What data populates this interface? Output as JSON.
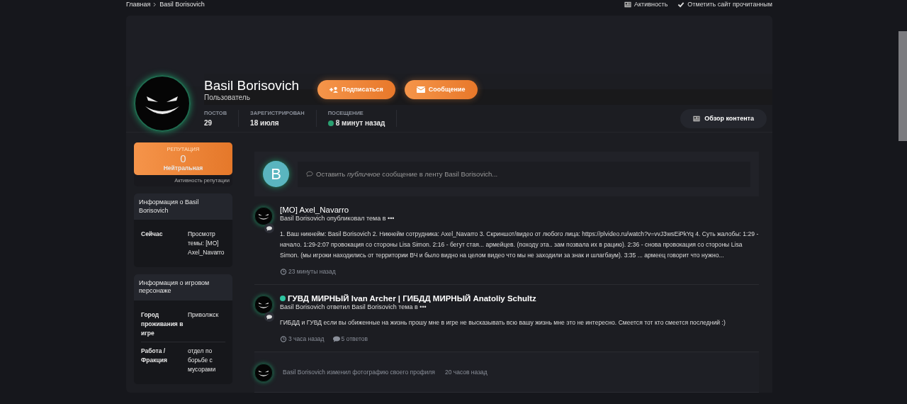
{
  "breadcrumb": [
    {
      "label": "Главная"
    },
    {
      "label": "Basil Borisovich"
    }
  ],
  "top_links": [
    {
      "kind": "activity",
      "label": "Активность"
    },
    {
      "kind": "mark_read",
      "label": "Отметить сайт прочитанным"
    }
  ],
  "profile": {
    "name": "Basil Borisovich",
    "group": "Пользователь",
    "online": true,
    "buttons": [
      {
        "kind": "follow",
        "label": "Подписаться"
      },
      {
        "kind": "message",
        "label": "Сообщение"
      }
    ],
    "stats": [
      {
        "label": "ПОСТОВ",
        "value": "29"
      },
      {
        "label": "ЗАРЕГИСТРИРОВАН",
        "value": "18 июля"
      },
      {
        "label": "ПОСЕЩЕНИЕ",
        "value": "8 минут назад",
        "online": true
      }
    ],
    "content_button": "Обзор контента"
  },
  "reputation": {
    "title": "РЕПУТАЦИЯ",
    "value": "0",
    "text": "Нейтральная",
    "link": "Активность репутации"
  },
  "info_blocks": [
    {
      "title": "Информация о Basil Borisovich",
      "rows": [
        {
          "label": "Сейчас",
          "value": "Просмотр темы: [MO] Axel_Navarro"
        }
      ]
    },
    {
      "title": "Информация о игровом персонаже",
      "rows": [
        {
          "label": "Город проживания в игре",
          "value": "Приволжск"
        },
        {
          "label": "Работа / Фракция",
          "value": "отдел по борьбе с мусорами"
        }
      ]
    }
  ],
  "composer": {
    "avatar_letter": "B",
    "placeholder": "Оставить *публичное* сообщение в ленту Basil Borisovich..."
  },
  "feed": [
    {
      "kind": "topic",
      "title": "[MO] Axel_Navarro",
      "online": false,
      "subtitle": "Basil Borisovich опубликовал тема в •••",
      "body": "1. Ваш никнейм: Basil Borisovich 2. Никнейм сотрудника: Axel_Navarro 3. Скриншот/видео от любого лица: https://plvideo.ru/watch?v=vvJ3wsEiPkYq 4. Суть жалобы: 1:29 - начало. 1:29-2:07 провокация со стороны Lisa Simon. 2:16 - бегут стая... армейцев. (походу эта.. зам позвала их в рацию). 2:36 - снова провокация со стороны Lisa Simon. (мы игроки находились от территории ВЧ и было видно на целом видео что мы не заходили за знак и шлагбаум). 3:35 ... армеец говорит что нужно...",
      "time": "23 минуты назад"
    },
    {
      "kind": "topic",
      "title": "ГУВД МИРНЫЙ Ivan Archer | ГИБДД МИРНЫЙ Anatoliy Schultz",
      "online": true,
      "subtitle": "Basil Borisovich ответил Basil Borisovich тема в •••",
      "body": "ГИБДД и ГУВД если вы обиженные на жизнь прошу мне в игре не высказывать всю вашу жизнь мне это не интересно. Смеется тот кто смеется последний :)",
      "time": "3 часа назад",
      "replies": "5 ответов"
    },
    {
      "kind": "photo_change",
      "text": "Basil Borisovich изменил фотографию своего профиля",
      "time": "20 часов назад"
    }
  ]
}
